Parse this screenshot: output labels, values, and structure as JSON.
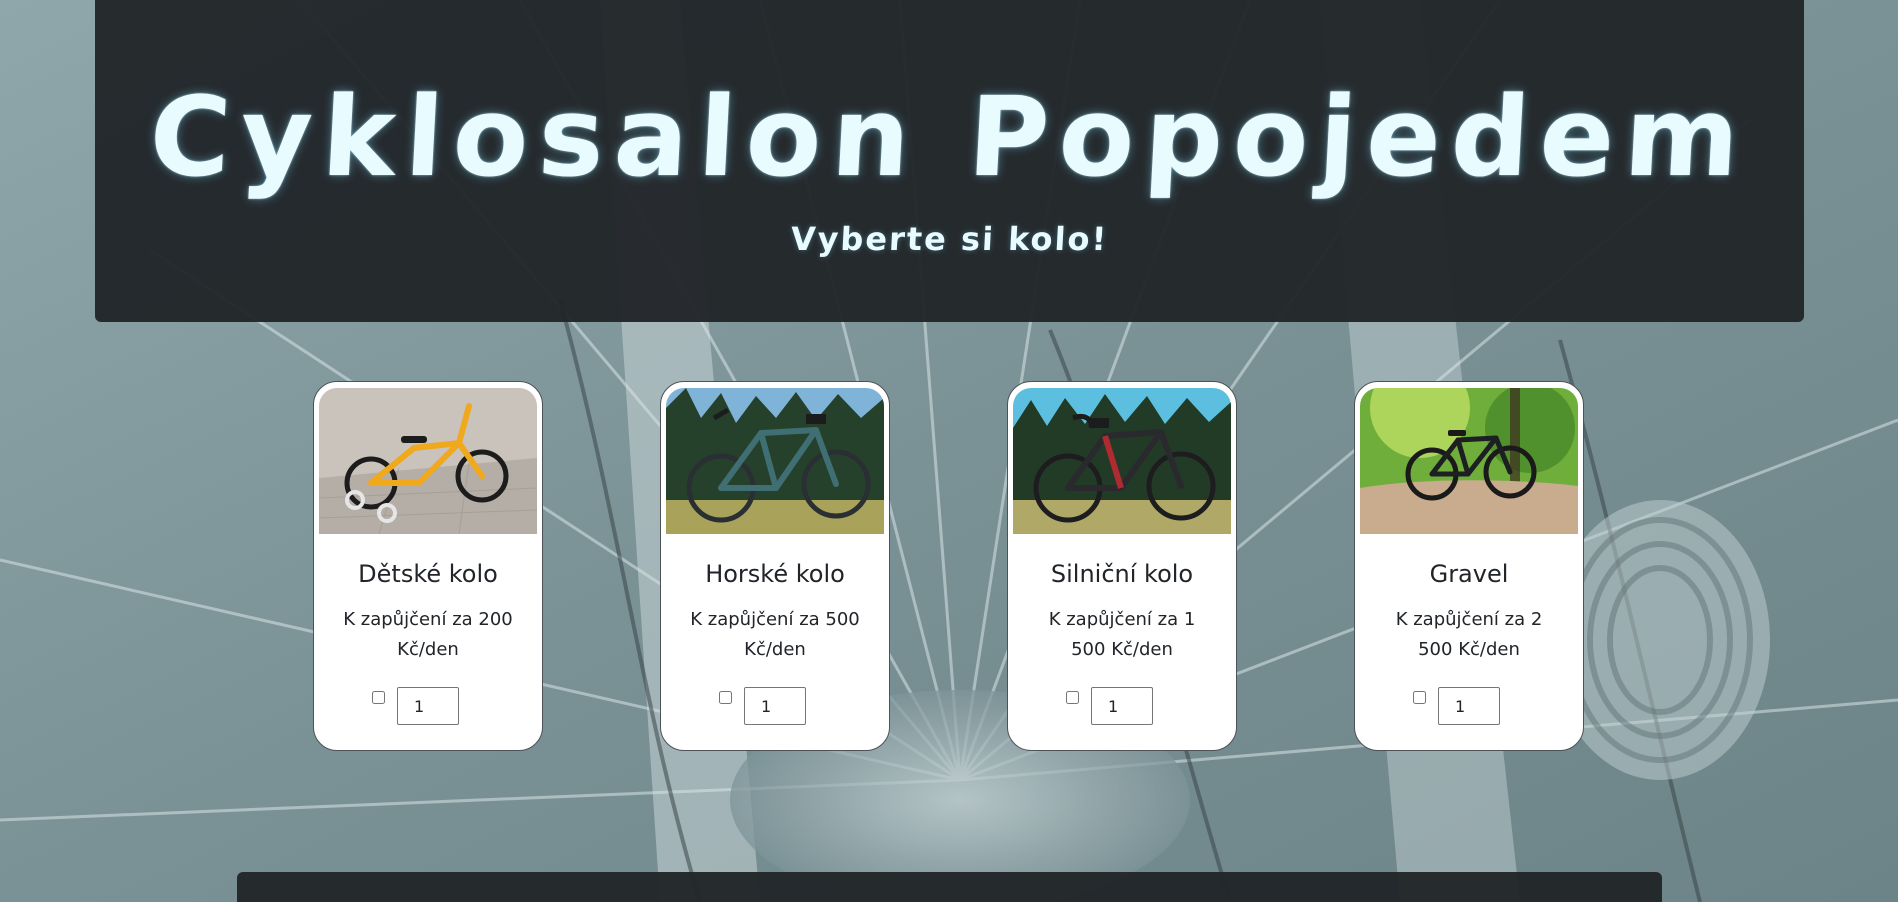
{
  "header": {
    "title": "Cyklosalon Popojedem",
    "subtitle": "Vyberte si kolo!"
  },
  "products": [
    {
      "name": "Dětské kolo",
      "price": "K zapůjčení za 200 Kč/den",
      "quantity": "1",
      "checked": false,
      "image": "yellow-kids-bike-photo",
      "bike_color": "#f0a81c"
    },
    {
      "name": "Horské kolo",
      "price": "K zapůjčení za 500 Kč/den",
      "quantity": "1",
      "checked": false,
      "image": "teal-mountain-bike-photo",
      "bike_color": "#3f6f73"
    },
    {
      "name": "Silniční kolo",
      "price": "K zapůjčení za 1 500 Kč/den",
      "quantity": "1",
      "checked": false,
      "image": "black-road-bike-photo",
      "bike_color": "#2a2a2e"
    },
    {
      "name": "Gravel",
      "price": "K zapůjčení za 2 500 Kč/den",
      "quantity": "1",
      "checked": false,
      "image": "black-gravel-bike-forest-photo",
      "bike_color": "#1d1f22"
    }
  ],
  "colors": {
    "header_bg": "#212529",
    "title_text": "#e8fbff",
    "page_bg": "#7f979b",
    "card_bg": "#ffffff"
  }
}
